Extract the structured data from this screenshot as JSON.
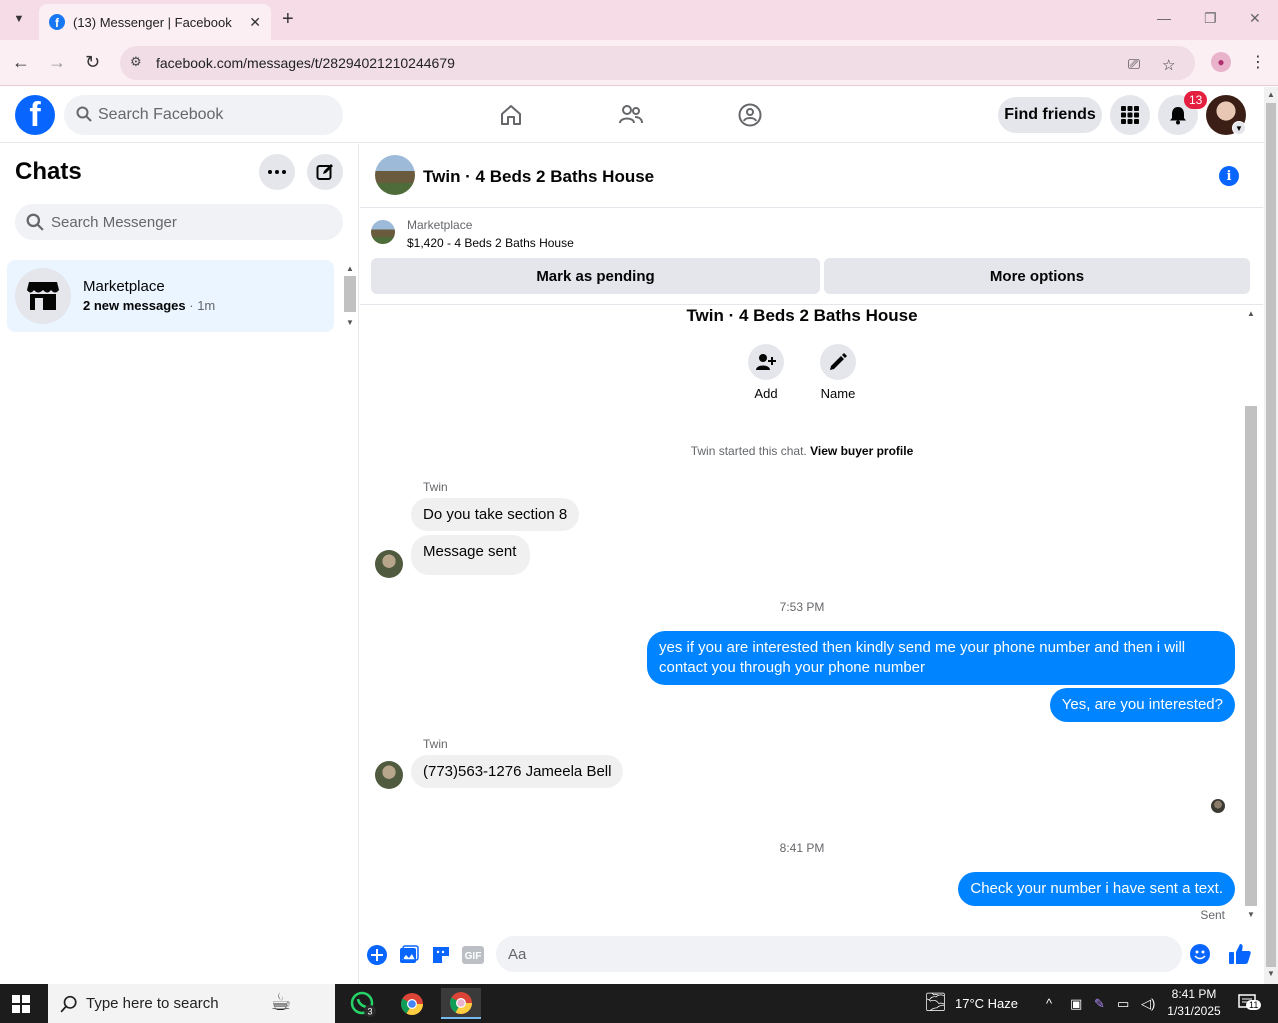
{
  "browser": {
    "tab_title": "(13) Messenger | Facebook",
    "url": "facebook.com/messages/t/28294021210244679"
  },
  "fb": {
    "search_placeholder": "Search Facebook",
    "find_friends": "Find friends",
    "notification_count": "13"
  },
  "sidebar": {
    "title": "Chats",
    "search_placeholder": "Search Messenger",
    "chats": [
      {
        "name": "Marketplace",
        "preview": "2 new messages",
        "time": "1m"
      }
    ]
  },
  "conversation": {
    "title": "Twin · 4 Beds 2 Baths House",
    "marketplace_label": "Marketplace",
    "listing": "$1,420 - 4 Beds 2 Baths House",
    "mark_pending": "Mark as pending",
    "more_options": "More options",
    "thread_title": "Twin · 4 Beds 2 Baths House",
    "add_label": "Add",
    "name_label": "Name",
    "started_text": "Twin started this chat.",
    "view_profile": "View buyer profile",
    "messages": [
      {
        "sender": "Twin",
        "text": "Do you take section 8"
      },
      {
        "text": "Message sent"
      },
      {
        "timestamp": "7:53 PM"
      },
      {
        "out": true,
        "text": "yes  if you are interested then kindly send me your phone number and then i will contact you through your phone number"
      },
      {
        "out": true,
        "text": "Yes, are you interested?"
      },
      {
        "sender": "Twin",
        "text": "(773)563-1276 Jameela Bell"
      },
      {
        "timestamp": "8:41 PM"
      },
      {
        "out": true,
        "text": "Check your number i have sent a text."
      }
    ],
    "status": "Sent",
    "composer_placeholder": "Aa"
  },
  "taskbar": {
    "search_placeholder": "Type here to search",
    "whatsapp_badge": "3",
    "weather": "17°C  Haze",
    "time": "8:41 PM",
    "date": "1/31/2025",
    "notif_count": "11"
  }
}
